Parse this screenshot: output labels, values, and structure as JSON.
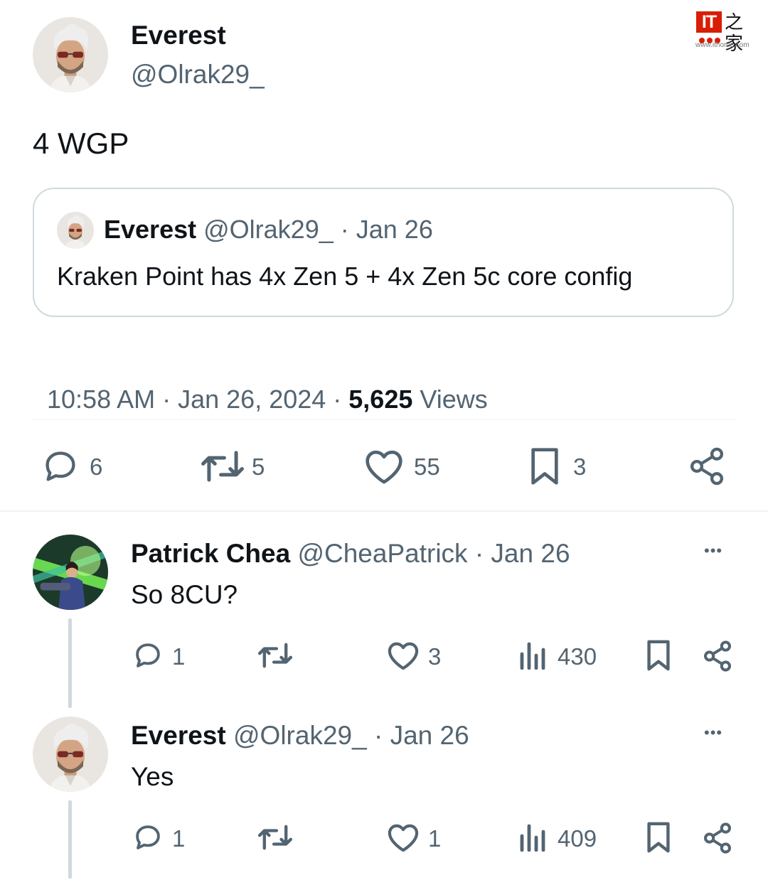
{
  "watermark": {
    "logo_text": "IT",
    "chinese": "之家",
    "url": "www.ithome.com"
  },
  "main_tweet": {
    "author_name": "Everest",
    "author_handle": "@Olrak29_",
    "text": "4 WGP",
    "quoted": {
      "author_name": "Everest",
      "author_handle": "@Olrak29_",
      "date": "· Jan 26",
      "text": "Kraken Point has 4x Zen 5 + 4x Zen 5c core config"
    },
    "meta": {
      "time": "10:58 AM · Jan 26, 2024 · ",
      "views_count": "5,625",
      "views_label": " Views"
    },
    "actions": {
      "replies": "6",
      "reposts": "5",
      "likes": "55",
      "bookmarks": "3"
    }
  },
  "replies": [
    {
      "author_name": "Patrick Chea",
      "author_handle": "@CheaPatrick",
      "date": "· Jan 26",
      "text": "So 8CU?",
      "more": "•••",
      "actions": {
        "replies": "1",
        "reposts": "",
        "likes": "3",
        "views": "430"
      }
    },
    {
      "author_name": "Everest",
      "author_handle": "@Olrak29_",
      "date": "· Jan 26",
      "text": "Yes",
      "more": "•••",
      "actions": {
        "replies": "1",
        "reposts": "",
        "likes": "1",
        "views": "409"
      }
    }
  ],
  "colors": {
    "text": "#0f1419",
    "secondary": "#536471",
    "border": "#cfd9de",
    "watermark_red": "#d81e06"
  },
  "icons": [
    "reply-icon",
    "repost-icon",
    "like-icon",
    "bookmark-icon",
    "share-icon",
    "views-icon",
    "more-icon"
  ]
}
